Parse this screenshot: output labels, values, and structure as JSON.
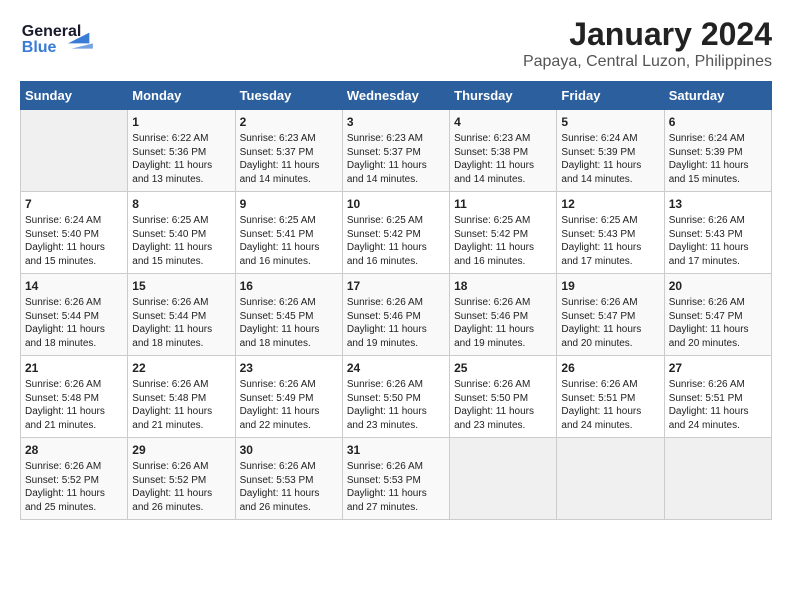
{
  "header": {
    "logo_general": "General",
    "logo_blue": "Blue",
    "month_title": "January 2024",
    "location": "Papaya, Central Luzon, Philippines"
  },
  "days_of_week": [
    "Sunday",
    "Monday",
    "Tuesday",
    "Wednesday",
    "Thursday",
    "Friday",
    "Saturday"
  ],
  "weeks": [
    [
      {
        "day": "",
        "sunrise": "",
        "sunset": "",
        "daylight": ""
      },
      {
        "day": "1",
        "sunrise": "Sunrise: 6:22 AM",
        "sunset": "Sunset: 5:36 PM",
        "daylight": "Daylight: 11 hours and 13 minutes."
      },
      {
        "day": "2",
        "sunrise": "Sunrise: 6:23 AM",
        "sunset": "Sunset: 5:37 PM",
        "daylight": "Daylight: 11 hours and 14 minutes."
      },
      {
        "day": "3",
        "sunrise": "Sunrise: 6:23 AM",
        "sunset": "Sunset: 5:37 PM",
        "daylight": "Daylight: 11 hours and 14 minutes."
      },
      {
        "day": "4",
        "sunrise": "Sunrise: 6:23 AM",
        "sunset": "Sunset: 5:38 PM",
        "daylight": "Daylight: 11 hours and 14 minutes."
      },
      {
        "day": "5",
        "sunrise": "Sunrise: 6:24 AM",
        "sunset": "Sunset: 5:39 PM",
        "daylight": "Daylight: 11 hours and 14 minutes."
      },
      {
        "day": "6",
        "sunrise": "Sunrise: 6:24 AM",
        "sunset": "Sunset: 5:39 PM",
        "daylight": "Daylight: 11 hours and 15 minutes."
      }
    ],
    [
      {
        "day": "7",
        "sunrise": "Sunrise: 6:24 AM",
        "sunset": "Sunset: 5:40 PM",
        "daylight": "Daylight: 11 hours and 15 minutes."
      },
      {
        "day": "8",
        "sunrise": "Sunrise: 6:25 AM",
        "sunset": "Sunset: 5:40 PM",
        "daylight": "Daylight: 11 hours and 15 minutes."
      },
      {
        "day": "9",
        "sunrise": "Sunrise: 6:25 AM",
        "sunset": "Sunset: 5:41 PM",
        "daylight": "Daylight: 11 hours and 16 minutes."
      },
      {
        "day": "10",
        "sunrise": "Sunrise: 6:25 AM",
        "sunset": "Sunset: 5:42 PM",
        "daylight": "Daylight: 11 hours and 16 minutes."
      },
      {
        "day": "11",
        "sunrise": "Sunrise: 6:25 AM",
        "sunset": "Sunset: 5:42 PM",
        "daylight": "Daylight: 11 hours and 16 minutes."
      },
      {
        "day": "12",
        "sunrise": "Sunrise: 6:25 AM",
        "sunset": "Sunset: 5:43 PM",
        "daylight": "Daylight: 11 hours and 17 minutes."
      },
      {
        "day": "13",
        "sunrise": "Sunrise: 6:26 AM",
        "sunset": "Sunset: 5:43 PM",
        "daylight": "Daylight: 11 hours and 17 minutes."
      }
    ],
    [
      {
        "day": "14",
        "sunrise": "Sunrise: 6:26 AM",
        "sunset": "Sunset: 5:44 PM",
        "daylight": "Daylight: 11 hours and 18 minutes."
      },
      {
        "day": "15",
        "sunrise": "Sunrise: 6:26 AM",
        "sunset": "Sunset: 5:44 PM",
        "daylight": "Daylight: 11 hours and 18 minutes."
      },
      {
        "day": "16",
        "sunrise": "Sunrise: 6:26 AM",
        "sunset": "Sunset: 5:45 PM",
        "daylight": "Daylight: 11 hours and 18 minutes."
      },
      {
        "day": "17",
        "sunrise": "Sunrise: 6:26 AM",
        "sunset": "Sunset: 5:46 PM",
        "daylight": "Daylight: 11 hours and 19 minutes."
      },
      {
        "day": "18",
        "sunrise": "Sunrise: 6:26 AM",
        "sunset": "Sunset: 5:46 PM",
        "daylight": "Daylight: 11 hours and 19 minutes."
      },
      {
        "day": "19",
        "sunrise": "Sunrise: 6:26 AM",
        "sunset": "Sunset: 5:47 PM",
        "daylight": "Daylight: 11 hours and 20 minutes."
      },
      {
        "day": "20",
        "sunrise": "Sunrise: 6:26 AM",
        "sunset": "Sunset: 5:47 PM",
        "daylight": "Daylight: 11 hours and 20 minutes."
      }
    ],
    [
      {
        "day": "21",
        "sunrise": "Sunrise: 6:26 AM",
        "sunset": "Sunset: 5:48 PM",
        "daylight": "Daylight: 11 hours and 21 minutes."
      },
      {
        "day": "22",
        "sunrise": "Sunrise: 6:26 AM",
        "sunset": "Sunset: 5:48 PM",
        "daylight": "Daylight: 11 hours and 21 minutes."
      },
      {
        "day": "23",
        "sunrise": "Sunrise: 6:26 AM",
        "sunset": "Sunset: 5:49 PM",
        "daylight": "Daylight: 11 hours and 22 minutes."
      },
      {
        "day": "24",
        "sunrise": "Sunrise: 6:26 AM",
        "sunset": "Sunset: 5:50 PM",
        "daylight": "Daylight: 11 hours and 23 minutes."
      },
      {
        "day": "25",
        "sunrise": "Sunrise: 6:26 AM",
        "sunset": "Sunset: 5:50 PM",
        "daylight": "Daylight: 11 hours and 23 minutes."
      },
      {
        "day": "26",
        "sunrise": "Sunrise: 6:26 AM",
        "sunset": "Sunset: 5:51 PM",
        "daylight": "Daylight: 11 hours and 24 minutes."
      },
      {
        "day": "27",
        "sunrise": "Sunrise: 6:26 AM",
        "sunset": "Sunset: 5:51 PM",
        "daylight": "Daylight: 11 hours and 24 minutes."
      }
    ],
    [
      {
        "day": "28",
        "sunrise": "Sunrise: 6:26 AM",
        "sunset": "Sunset: 5:52 PM",
        "daylight": "Daylight: 11 hours and 25 minutes."
      },
      {
        "day": "29",
        "sunrise": "Sunrise: 6:26 AM",
        "sunset": "Sunset: 5:52 PM",
        "daylight": "Daylight: 11 hours and 26 minutes."
      },
      {
        "day": "30",
        "sunrise": "Sunrise: 6:26 AM",
        "sunset": "Sunset: 5:53 PM",
        "daylight": "Daylight: 11 hours and 26 minutes."
      },
      {
        "day": "31",
        "sunrise": "Sunrise: 6:26 AM",
        "sunset": "Sunset: 5:53 PM",
        "daylight": "Daylight: 11 hours and 27 minutes."
      },
      {
        "day": "",
        "sunrise": "",
        "sunset": "",
        "daylight": ""
      },
      {
        "day": "",
        "sunrise": "",
        "sunset": "",
        "daylight": ""
      },
      {
        "day": "",
        "sunrise": "",
        "sunset": "",
        "daylight": ""
      }
    ]
  ]
}
